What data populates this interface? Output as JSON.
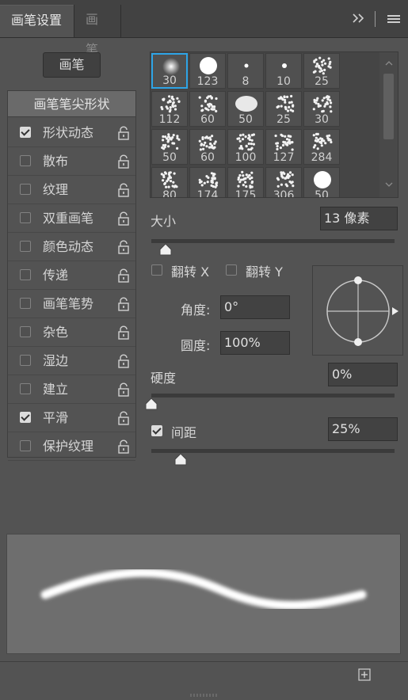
{
  "tabs": [
    {
      "label": "画笔设置",
      "active": true
    },
    {
      "label": "画笔",
      "active": false
    }
  ],
  "tabbar_icons": [
    "expand-icon",
    "panel-menu-icon"
  ],
  "brushes_button": "画笔",
  "tip_shape_header": "画笔笔尖形状",
  "options": [
    {
      "label": "形状动态",
      "checked": true
    },
    {
      "label": "散布",
      "checked": false
    },
    {
      "label": "纹理",
      "checked": false
    },
    {
      "label": "双重画笔",
      "checked": false
    },
    {
      "label": "颜色动态",
      "checked": false
    },
    {
      "label": "传递",
      "checked": false
    },
    {
      "label": "画笔笔势",
      "checked": false
    },
    {
      "label": "杂色",
      "checked": false
    },
    {
      "label": "湿边",
      "checked": false
    },
    {
      "label": "建立",
      "checked": false
    },
    {
      "label": "平滑",
      "checked": true
    },
    {
      "label": "保护纹理",
      "checked": false
    }
  ],
  "brush_sizes": [
    [
      "30",
      "123",
      "8",
      "10",
      "25"
    ],
    [
      "112",
      "60",
      "50",
      "25",
      "30"
    ],
    [
      "50",
      "60",
      "100",
      "127",
      "284"
    ],
    [
      "80",
      "174",
      "175",
      "306",
      "50"
    ]
  ],
  "selected_brush": "30",
  "size": {
    "label": "大小",
    "value": "13 像素",
    "slider": 0.06
  },
  "flip_x": {
    "label": "翻转 X",
    "checked": false
  },
  "flip_y": {
    "label": "翻转 Y",
    "checked": false
  },
  "angle": {
    "label": "角度:",
    "value": "0°"
  },
  "roundness": {
    "label": "圆度:",
    "value": "100%"
  },
  "hardness": {
    "label": "硬度",
    "value": "0%",
    "slider": 0.0
  },
  "spacing": {
    "label": "间距",
    "value": "25%",
    "checked": true,
    "slider": 0.12
  },
  "footer_icons": [
    "new-brush-icon"
  ],
  "colors": {
    "accent": "#2ea4e6",
    "panel_bg": "#535353",
    "preview_bg": "#6e6e6e"
  }
}
